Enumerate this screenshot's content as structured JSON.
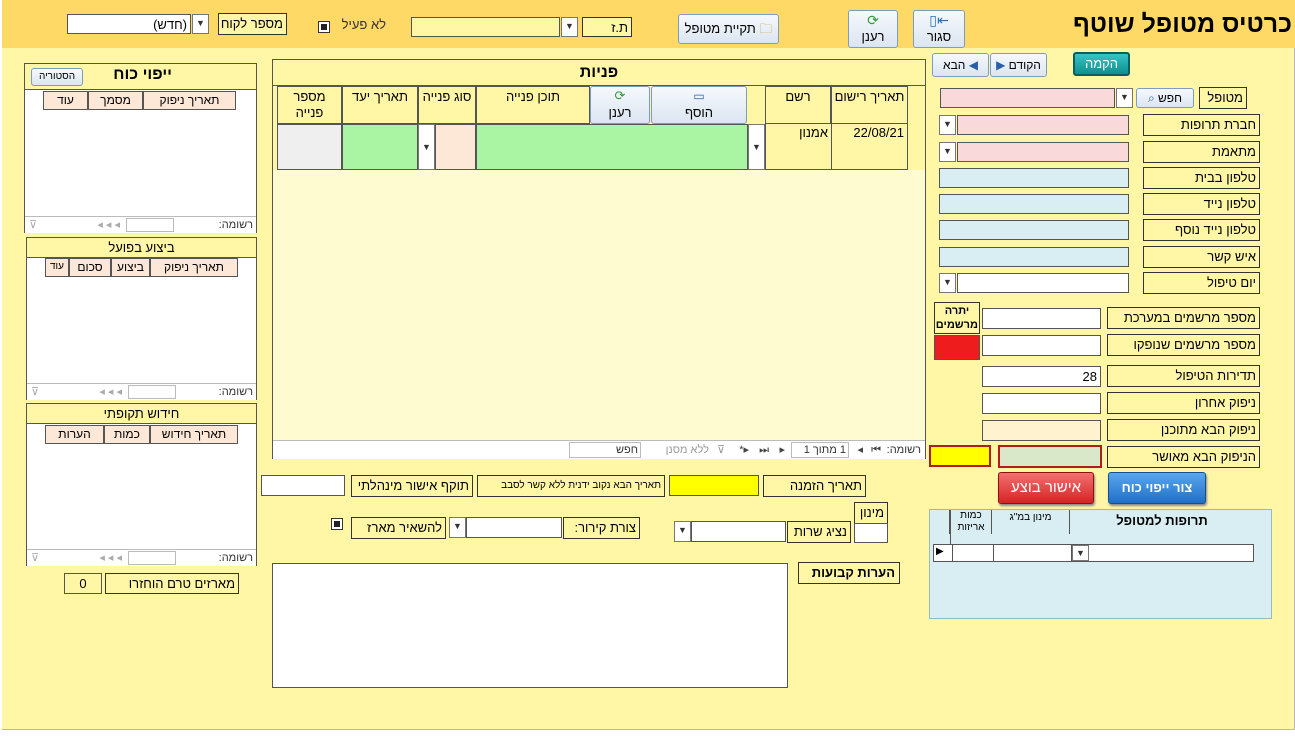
{
  "header": {
    "title": "כרטיס מטופל שוטף",
    "close_label": "סגור",
    "refresh_label": "רענן",
    "patient_folder_label": "תקיית מטופל",
    "id_label": "ת.ז",
    "id_value": "",
    "inactive_label": "לא פעיל",
    "customer_number_label": "מספר לקוח",
    "customer_number_value": "(חדש)"
  },
  "nav": {
    "setup_label": "הקמה",
    "prev_label": "הקודם",
    "next_label": "הבא"
  },
  "patient_form": {
    "patient_label": "מטופל",
    "search_label": "חפש",
    "patient_value": "",
    "fields": [
      {
        "label": "חברת תרופות",
        "value": ""
      },
      {
        "label": "מתאמת",
        "value": ""
      },
      {
        "label": "טלפון בבית",
        "value": ""
      },
      {
        "label": "טלפון נייד",
        "value": ""
      },
      {
        "label": "טלפון נייד נוסף",
        "value": ""
      },
      {
        "label": "איש קשר",
        "value": ""
      },
      {
        "label": "יום טיפול",
        "value": ""
      }
    ],
    "prescription_balance_label": "יתרה מרשמים",
    "prescriptions_in_system_label": "מספר מרשמים במערכת",
    "prescriptions_in_system_value": "",
    "prescriptions_supplied_label": "מספר מרשמים שנופקו",
    "prescriptions_supplied_value": "",
    "treatment_frequency_label": "תדירות הטיפול",
    "treatment_frequency_value": "28",
    "last_supply_label": "ניפוק אחרון",
    "last_supply_value": "",
    "next_planned_supply_label": "ניפוק הבא מתוכנן",
    "next_planned_supply_value": "",
    "next_approved_supply_label": "הניפוק הבא מאושר",
    "next_approved_supply_value": ""
  },
  "actions": {
    "create_power_label": "צור ייפוי כוח",
    "confirm_done_label": "אישור בוצע"
  },
  "patient_drugs": {
    "headers": [
      "תרופות למטופל",
      "מינון במ\"ג",
      "כמות אריזות"
    ]
  },
  "inquiries": {
    "title": "פניות",
    "add_label": "הוסף",
    "refresh_label": "רענן",
    "headers": [
      "תאריך רישום",
      "רשם",
      "תוכן פנייה",
      "סוג פנייה",
      "תאריך יעד",
      "מספר פנייה"
    ],
    "rows": [
      {
        "date": "22/08/21",
        "recorder": "אמנון",
        "content": "",
        "type": "",
        "due_date": "",
        "number": ""
      }
    ],
    "footer": {
      "record_label": "רשומה:",
      "position": "1 מתוך 1",
      "filter_label": "ללא מסנן",
      "search_label": "חפש"
    }
  },
  "power_of_attorney": {
    "title": "ייפוי כוח",
    "history_label": "הסטוריה",
    "headers": [
      "תאריך ניפוק",
      "מסמך",
      "עוד"
    ],
    "footer_label": "רשומה:"
  },
  "actual_execution": {
    "title": "ביצוע בפועל",
    "headers": [
      "תאריך ניפוק",
      "ביצוע",
      "סכום",
      "עוד"
    ],
    "footer_label": "רשומה:"
  },
  "periodic_renewal": {
    "title": "חידוש  תקופתי",
    "headers": [
      "תאריך חידוש",
      "כמות",
      "הערות"
    ],
    "footer_label": "רשומה:"
  },
  "unreturned": {
    "label": "מארזים טרם הוחזרו",
    "value": "0"
  },
  "order": {
    "order_date_label": "תאריך הזמנה",
    "order_date_value": "",
    "next_manual_date_label": "תאריך הבא נקוב ידנית ללא קשר לסבב",
    "next_manual_date_value": "",
    "mgmt_approval_label": "תוקף אישור מינהלתי",
    "mgmt_approval_value": "",
    "dosage_label": "מינון",
    "dosage_value": "",
    "service_rep_label": "נציג שרות",
    "service_rep_value": "",
    "cooling_label": "צורת קירור:",
    "cooling_value": "",
    "leave_package_label": "להשאיר מארז"
  },
  "notes": {
    "label": "הערות קבועות",
    "value": ""
  },
  "colors": {
    "form_bg": "#fff7a6",
    "header_bg": "#ffd966",
    "setup_btn": "#17a6a6",
    "confirm_btn": "#e0383b",
    "create_btn": "#2f80d1",
    "alert_red": "#ee1c1c",
    "highlight_yellow": "#ffff00",
    "green_field": "#a9f5a4"
  }
}
